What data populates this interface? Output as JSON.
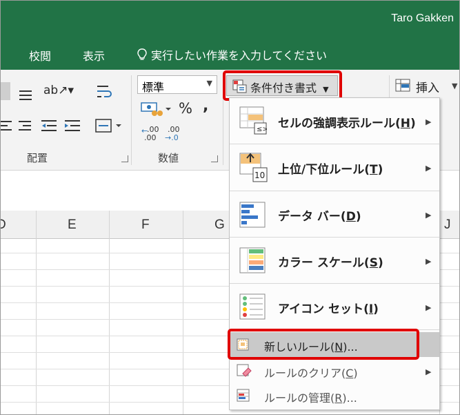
{
  "titlebar": {
    "user": "Taro Gakken"
  },
  "tabs": [
    {
      "label": "校閲"
    },
    {
      "label": "表示"
    }
  ],
  "tell_me": {
    "text": "実行したい作業を入力してください"
  },
  "ribbon": {
    "alignment_group_label": "配置",
    "number_group_label": "数値",
    "number_format_value": "標準",
    "percent_symbol": "%",
    "comma_symbol": ",",
    "conditional_formatting_label": "条件付き書式",
    "insert_label": "挿入",
    "inc_decimal_label": ".00",
    "dec_decimal_label": ".00"
  },
  "columns": [
    "D",
    "E",
    "F",
    "G",
    "J"
  ],
  "menu": {
    "items": [
      {
        "label": "セルの強調表示ルール(",
        "key": "H",
        "tail": ")",
        "icon": "highlight-cells-rules-icon"
      },
      {
        "label": "上位/下位ルール(",
        "key": "T",
        "tail": ")",
        "icon": "top-bottom-rules-icon",
        "icon_text": "10"
      },
      {
        "label": "データ バー(",
        "key": "D",
        "tail": ")",
        "icon": "data-bars-icon"
      },
      {
        "label": "カラー スケール(",
        "key": "S",
        "tail": ")",
        "icon": "color-scales-icon"
      },
      {
        "label": "アイコン セット(",
        "key": "I",
        "tail": ")",
        "icon": "icon-sets-icon"
      }
    ],
    "small_items": [
      {
        "label": "新しいルール(",
        "key": "N",
        "tail": ")...",
        "icon": "new-rule-icon",
        "highlighted": true
      },
      {
        "label": "ルールのクリア(",
        "key": "C",
        "tail": ")",
        "icon": "clear-rules-icon",
        "has_submenu": true
      },
      {
        "label": "ルールの管理(",
        "key": "R",
        "tail": ")...",
        "icon": "manage-rules-icon"
      }
    ]
  },
  "colors": {
    "excel_green": "#217346",
    "highlight_red": "#e00000",
    "menu_hover": "#c9c9c9"
  }
}
